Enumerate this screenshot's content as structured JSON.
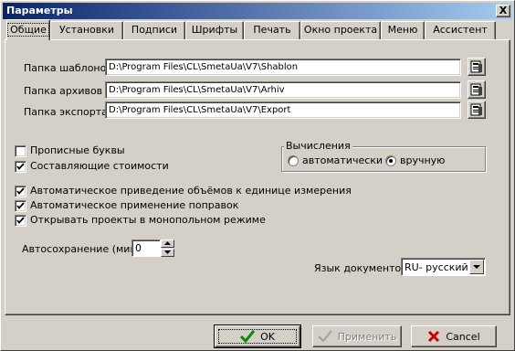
{
  "window": {
    "title": "Параметры",
    "close_label": "X"
  },
  "tabs": [
    {
      "label": "Общие"
    },
    {
      "label": "Установки"
    },
    {
      "label": "Подписи"
    },
    {
      "label": "Шрифты"
    },
    {
      "label": "Печать"
    },
    {
      "label": "Окно проекта"
    },
    {
      "label": "Меню"
    },
    {
      "label": "Ассистент"
    }
  ],
  "folders": {
    "templates": {
      "label": "Папка шаблонов",
      "value": "D:\\Program Files\\CL\\SmetaUa\\V7\\Shablon"
    },
    "archive": {
      "label": "Папка архивов",
      "value": "D:\\Program Files\\CL\\SmetaUa\\V7\\Arhiv"
    },
    "export": {
      "label": "Папка экспорта",
      "value": "D:\\Program Files\\CL\\SmetaUa\\V7\\Export"
    }
  },
  "options": {
    "uppercase": {
      "label": "Прописные буквы",
      "checked": false
    },
    "components": {
      "label": "Составляющие стоимости",
      "checked": true
    },
    "auto_unit": {
      "label": "Автоматическое приведение объёмов к единице измерения",
      "checked": true
    },
    "auto_corr": {
      "label": "Автоматическое применение поправок",
      "checked": true
    },
    "exclusive": {
      "label": "Открывать проекты в монопольном режиме",
      "checked": true
    }
  },
  "calc": {
    "title": "Вычисления",
    "auto_label": "автоматически",
    "manual_label": "вручную",
    "selected": "manual"
  },
  "autosave": {
    "label": "Автосохранение (мин.)",
    "value": "0"
  },
  "doc_lang": {
    "label": "Язык документов",
    "value": "RU- русский"
  },
  "buttons": {
    "ok": "OK",
    "apply": "Применить",
    "cancel": "Cancel"
  },
  "colors": {
    "title_start": "#0a246a",
    "title_end": "#a6caf0",
    "face": "#d4d0c8",
    "ok_check": "#0a8a0a",
    "cancel_x": "#cc0000"
  }
}
